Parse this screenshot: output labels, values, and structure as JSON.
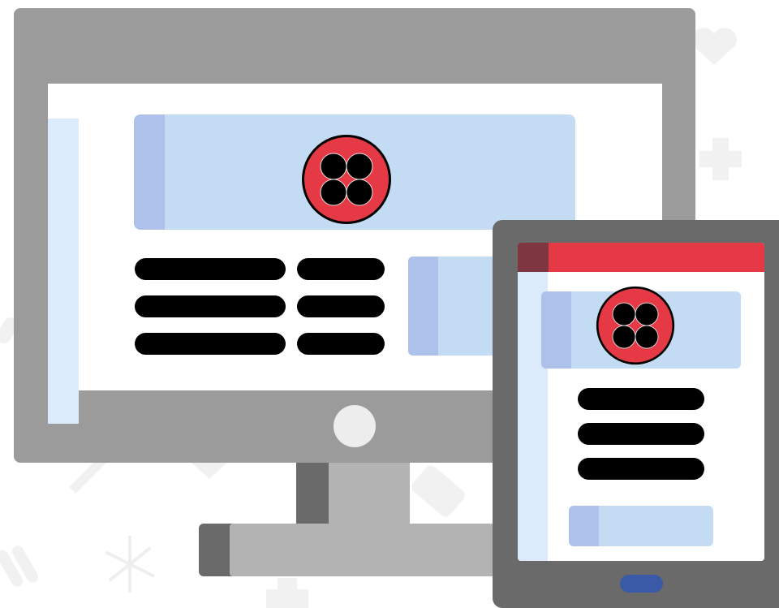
{
  "colors": {
    "monitor_frame": "#9b9b9b",
    "tablet_frame": "#6a6a6a",
    "card_light": "#c3dcf3",
    "card_accent": "#aec1ea",
    "sidebar": "#dcebfb",
    "brand_red": "#e63946",
    "brand_dark_red": "#7e3640",
    "home_button": "#3a5aa7",
    "text_placeholder": "#000000"
  },
  "icons": {
    "logo": "four-dot-circle-logo",
    "background": [
      "heart-pulse-icon",
      "medical-cross-icon",
      "syringe-icon",
      "pill-pack-icon",
      "test-tubes-icon",
      "molecule-icon"
    ]
  },
  "monitor": {
    "text_lines_left": 3,
    "text_lines_right": 3
  },
  "tablet": {
    "text_lines": 3
  }
}
